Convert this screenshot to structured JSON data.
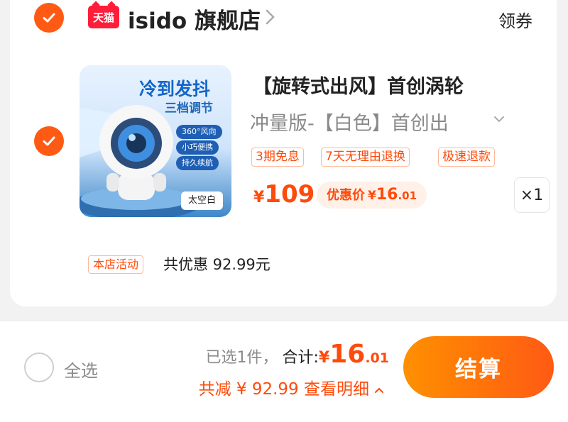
{
  "store": {
    "platform_logo": "天猫",
    "name": "isido 旗舰店",
    "coupon_label": "领券"
  },
  "item": {
    "image": {
      "headline": "冷到发抖",
      "subline": "三档调节",
      "features": [
        "360°风向",
        "小巧便携",
        "持久续航"
      ],
      "variant_chip": "太空白"
    },
    "title": "【旋转式出风】首创涡轮",
    "variant": "冲量版-【白色】首创出",
    "tags": [
      "3期免息",
      "7天无理由退换",
      "极速退款"
    ],
    "price": {
      "currency": "¥",
      "value": "109"
    },
    "promo": {
      "label": "优惠价",
      "currency": "¥",
      "integer": "16",
      "decimal": ".01"
    },
    "quantity": "×1"
  },
  "activity": {
    "badge": "本店活动",
    "text": "共优惠 92.99元"
  },
  "bottom_bar": {
    "select_all": "全选",
    "selected_count": "已选1件，",
    "total_label": "合计:",
    "total_currency": "¥",
    "total_integer": "16",
    "total_decimal": ".01",
    "savings": "共减 ¥ 92.99 查看明细",
    "checkout": "结算"
  },
  "colors": {
    "accent": "#ff5a14",
    "checkout_gradient_start": "#ff9000",
    "tmall_red": "#ff1d3a"
  }
}
